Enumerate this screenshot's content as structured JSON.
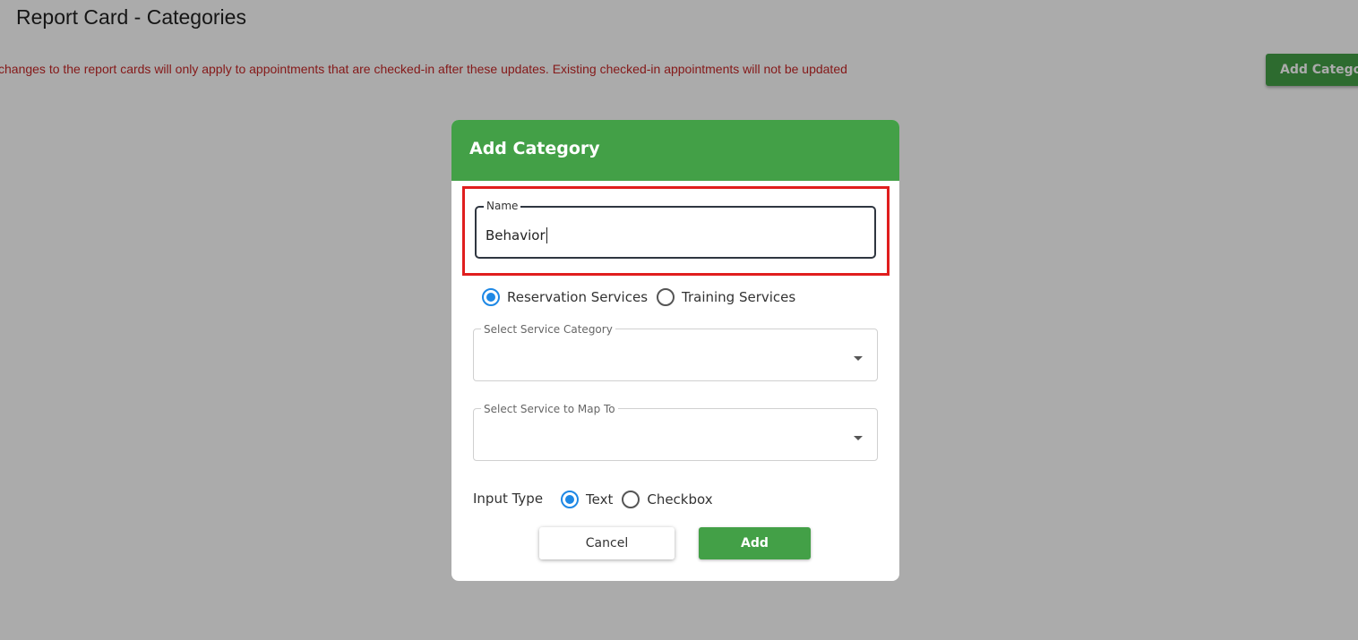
{
  "page": {
    "title": "Report Card - Categories",
    "notice": "changes to the report cards will only apply to appointments that are checked-in after these updates. Existing checked-in appointments will not be updated",
    "add_category_button": "Add Category"
  },
  "dialog": {
    "title": "Add Category",
    "name_field": {
      "label": "Name",
      "value": "Behavior"
    },
    "service_type": {
      "options": [
        {
          "label": "Reservation Services",
          "checked": true
        },
        {
          "label": "Training Services",
          "checked": false
        }
      ]
    },
    "service_category_select": {
      "label": "Select Service Category",
      "value": ""
    },
    "service_map_select": {
      "label": "Select Service to Map To",
      "value": ""
    },
    "input_type": {
      "label": "Input Type",
      "options": [
        {
          "label": "Text",
          "checked": true
        },
        {
          "label": "Checkbox",
          "checked": false
        }
      ]
    },
    "buttons": {
      "cancel": "Cancel",
      "add": "Add"
    }
  },
  "colors": {
    "brand_green": "#43a047",
    "notice_red": "#c62828",
    "radio_blue": "#1e88e5",
    "highlight_red": "#e01e1e"
  }
}
